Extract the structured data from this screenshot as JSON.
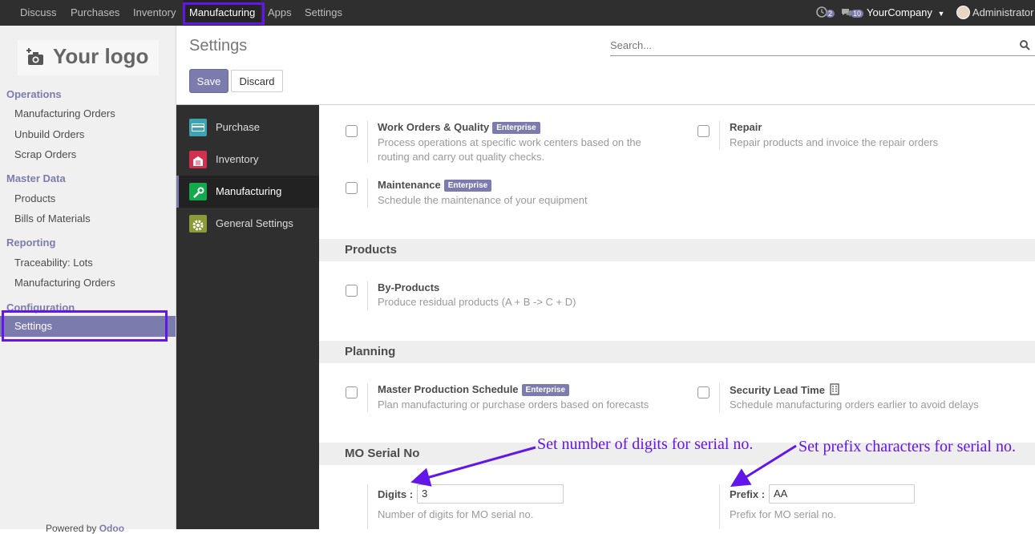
{
  "topbar": {
    "menus": [
      "Discuss",
      "Purchases",
      "Inventory",
      "Manufacturing",
      "Apps",
      "Settings"
    ],
    "chat_count": "2",
    "messages_count": "10",
    "company": "YourCompany",
    "user": "Administrator"
  },
  "logo_text": "Your logo",
  "sidebar": {
    "sections": [
      {
        "title": "Operations",
        "items": [
          "Manufacturing Orders",
          "Unbuild Orders",
          "Scrap Orders"
        ]
      },
      {
        "title": "Master Data",
        "items": [
          "Products",
          "Bills of Materials"
        ]
      },
      {
        "title": "Reporting",
        "items": [
          "Traceability: Lots",
          "Manufacturing Orders"
        ]
      },
      {
        "title": "Configuration",
        "items": [
          "Settings"
        ]
      }
    ],
    "footer": "Powered by",
    "footer_brand": "Odoo"
  },
  "control_panel": {
    "title": "Settings",
    "search_placeholder": "Search...",
    "save_label": "Save",
    "discard_label": "Discard"
  },
  "apps": [
    "Purchase",
    "Inventory",
    "Manufacturing",
    "General Settings"
  ],
  "options": {
    "work_orders": {
      "title": "Work Orders & Quality",
      "badge": "Enterprise",
      "desc": "Process operations at specific work centers based on the routing and carry out quality checks."
    },
    "repair": {
      "title": "Repair",
      "desc": "Repair products and invoice the repair orders"
    },
    "maintenance": {
      "title": "Maintenance",
      "badge": "Enterprise",
      "desc": "Schedule the maintenance of your equipment"
    },
    "by_products": {
      "title": "By-Products",
      "desc": "Produce residual products (A + B -> C + D)"
    },
    "mps": {
      "title": "Master Production Schedule",
      "badge": "Enterprise",
      "desc": "Plan manufacturing or purchase orders based on forecasts"
    },
    "security_lead": {
      "title": "Security Lead Time",
      "desc": "Schedule manufacturing orders earlier to avoid delays"
    }
  },
  "sections": {
    "products": "Products",
    "planning": "Planning",
    "mo_serial": "MO Serial No"
  },
  "serial": {
    "digits_label": "Digits :",
    "digits_value": "3",
    "digits_desc": "Number of digits for MO serial no.",
    "prefix_label": "Prefix :",
    "prefix_value": "AA",
    "prefix_desc": "Prefix for MO serial no."
  },
  "annotations": {
    "digits": "Set number of digits for serial no.",
    "prefix": "Set prefix characters for serial no."
  },
  "colors": {
    "accent": "#7c7bad",
    "highlight": "#6316e9",
    "topbar": "#2f2f2f"
  }
}
